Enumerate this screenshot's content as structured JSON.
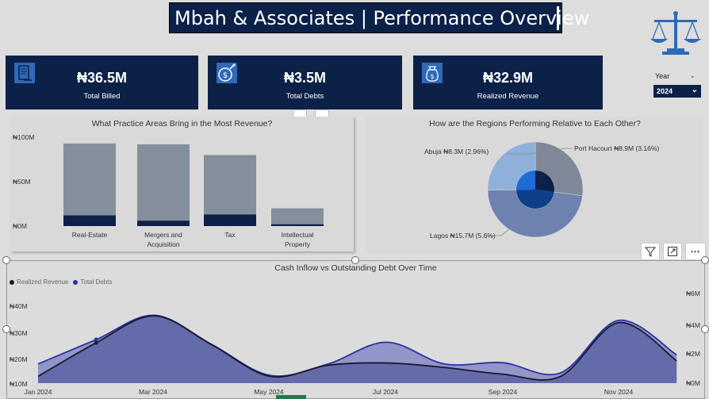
{
  "header": {
    "title": "Mbah & Associates | Performance Overview"
  },
  "kpis": [
    {
      "value": "₦36.5M",
      "label": "Total Billed",
      "icon": "invoice-icon"
    },
    {
      "value": "₦3.5M",
      "label": "Total Debts",
      "icon": "money-bomb-icon"
    },
    {
      "value": "₦32.9M",
      "label": "Realized Revenue",
      "icon": "money-bag-icon"
    }
  ],
  "slicer": {
    "label": "Year",
    "value": "2024"
  },
  "logo": "scales-of-justice-icon",
  "colors": {
    "navy": "#0c2147",
    "bar_gray": "#848e9c",
    "area_fill": "#5a64a6",
    "line_dark": "#1a1a2e",
    "line_blue": "#2b33a3"
  },
  "charts": {
    "practice": {
      "title": "What Practice Areas Bring in the Most Revenue?",
      "yticks": [
        "₦100M",
        "₦50M",
        "₦0M"
      ]
    },
    "regions": {
      "title": "How are the Regions Performing Relative to Each Other?",
      "labels": {
        "abuja": "Abuja ₦8.3M (2.96%)",
        "port": "Port Hacourt ₦8.9M (3.16%)",
        "lagos": "Lagos ₦15.7M (5.6%)"
      }
    },
    "cash": {
      "title": "Cash Inflow vs Outstanding Debt Over Time",
      "legend": [
        "Realized Revenue",
        "Total Debts"
      ],
      "yticks_left": [
        "₦40M",
        "₦30M",
        "₦20M",
        "₦10M"
      ],
      "yticks_right": [
        "₦6M",
        "₦4M",
        "₦2M",
        "₦0M"
      ],
      "xticks": [
        "Jan 2024",
        "Mar 2024",
        "May 2024",
        "Jul 2024",
        "Sep 2024",
        "Nov 2024"
      ]
    }
  },
  "chart_data": [
    {
      "type": "bar",
      "title": "What Practice Areas Bring in the Most Revenue?",
      "categories": [
        "Real-Estate",
        "Mergers and Acquisition",
        "Tax",
        "Intellectual Property"
      ],
      "series": [
        {
          "values": [
            93,
            92,
            80,
            20
          ]
        },
        {
          "values": [
            12,
            6,
            13,
            2
          ]
        }
      ],
      "ylim": [
        0,
        100
      ]
    },
    {
      "type": "pie",
      "title": "How are the Regions Performing Relative to Each Other?",
      "categories": [
        "Port Hacourt",
        "Lagos",
        "Abuja"
      ],
      "values": [
        8.9,
        15.7,
        8.3
      ],
      "labels": [
        "Port Hacourt ₦8.9M (3.16%)",
        "Lagos ₦15.7M (5.6%)",
        "Abuja ₦8.3M (2.96%)"
      ]
    },
    {
      "type": "area",
      "title": "Cash Inflow vs Outstanding Debt Over Time",
      "x": [
        "Jan",
        "Feb",
        "Mar",
        "Apr",
        "May",
        "Jun",
        "Jul",
        "Aug",
        "Sep",
        "Oct",
        "Nov",
        "Dec"
      ],
      "series": [
        {
          "name": "Realized Revenue",
          "axis": "left",
          "values": [
            13,
            28,
            40,
            27,
            13,
            18,
            19,
            17,
            14,
            13,
            37,
            20
          ]
        },
        {
          "name": "Total Debts",
          "axis": "right",
          "values": [
            1.5,
            3.4,
            5.3,
            3.0,
            0.6,
            1.5,
            3.2,
            1.5,
            1.6,
            0.8,
            4.9,
            2.2
          ]
        }
      ],
      "ylim_left": [
        10,
        50
      ],
      "ylim_right": [
        0,
        7
      ]
    }
  ]
}
